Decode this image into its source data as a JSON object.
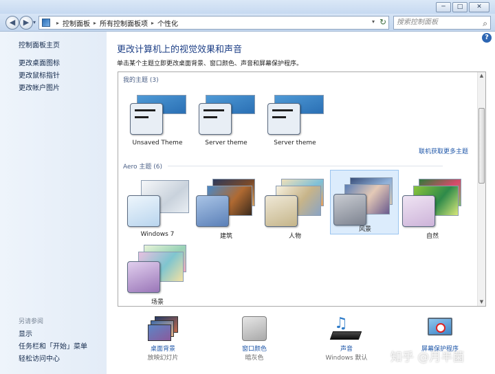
{
  "window": {
    "minimize": "─",
    "maximize": "□",
    "close": "✕"
  },
  "nav": {
    "back": "◀",
    "forward": "▶",
    "breadcrumb": [
      "控制面板",
      "所有控制面板项",
      "个性化"
    ],
    "search_placeholder": "搜索控制面板"
  },
  "sidebar": {
    "home": "控制面板主页",
    "links": [
      "更改桌面图标",
      "更改鼠标指针",
      "更改帐户图片"
    ],
    "see_also_heading": "另请参阅",
    "see_also": [
      "显示",
      "任务栏和「开始」菜单",
      "轻松访问中心"
    ]
  },
  "main": {
    "help": "?",
    "title": "更改计算机上的视觉效果和声音",
    "description": "单击某个主题立即更改桌面背景、窗口颜色、声音和屏幕保护程序。",
    "my_themes_heading": "我的主题 (3)",
    "my_themes": [
      "Unsaved Theme",
      "Server theme",
      "Server theme"
    ],
    "online_link": "联机获取更多主题",
    "aero_heading": "Aero 主题 (6)",
    "aero_themes": [
      "Windows 7",
      "建筑",
      "人物",
      "风景",
      "自然",
      "场景"
    ],
    "selected_theme": "风景"
  },
  "bottom": [
    {
      "label": "桌面背景",
      "sub": "放映幻灯片",
      "icon": "desktop-background-icon"
    },
    {
      "label": "窗口颜色",
      "sub": "暗灰色",
      "icon": "window-color-icon"
    },
    {
      "label": "声音",
      "sub": "Windows 默认",
      "icon": "sound-icon"
    },
    {
      "label": "屏幕保护程序",
      "sub": "",
      "icon": "screensaver-icon"
    }
  ],
  "watermark": "知乎 @月半菌",
  "colors": {
    "link": "#1f57a9",
    "title": "#1d3f86",
    "selection": "#dcecfc"
  }
}
